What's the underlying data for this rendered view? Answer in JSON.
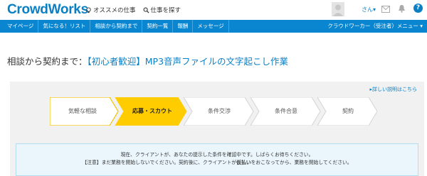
{
  "header": {
    "logo": "CrowdWorks",
    "links": [
      {
        "label": "オススメの仕事",
        "icon": "lightbulb-icon"
      },
      {
        "label": "仕事を探す",
        "icon": "search-icon"
      }
    ],
    "user_menu": "さん▾",
    "icons": [
      "avatar",
      "mail-icon",
      "bell-icon",
      "help-icon"
    ],
    "help_glyph": "?"
  },
  "nav": {
    "items": [
      "マイページ",
      "気になる！リスト",
      "相談から契約まで",
      "契約一覧",
      "報酬",
      "メッセージ"
    ],
    "right": "クラウドワーカー（受注者）メニュー ▾",
    "color": "#0a86d0"
  },
  "page": {
    "title_prefix": "相談から契約まで：",
    "title_job": "【初心者歓迎】MP3音声ファイルの文字起こし作業"
  },
  "panel": {
    "detail_link": "▸詳しい説明はこちら",
    "steps": [
      {
        "label": "気軽な相談",
        "state": "done"
      },
      {
        "label": "応募・スカウト",
        "state": "active"
      },
      {
        "label": "条件交渉",
        "state": "pending"
      },
      {
        "label": "条件合意",
        "state": "pending"
      },
      {
        "label": "契約",
        "state": "pending"
      }
    ],
    "notice_line1": "現在、クライアントが、あなたの提示した条件を確認中です。しばらくお待ちください。",
    "notice_line2_a": "【注意】まだ業務を開始しないでください。契約後に、クライアントが",
    "notice_line2_bold": "仮払い",
    "notice_line2_b": "をおこなってから、業務を開始してください。",
    "colors": {
      "active": "#ffcc00",
      "done_border": "#f2c200",
      "notice_bg": "#eaf6fc"
    }
  }
}
